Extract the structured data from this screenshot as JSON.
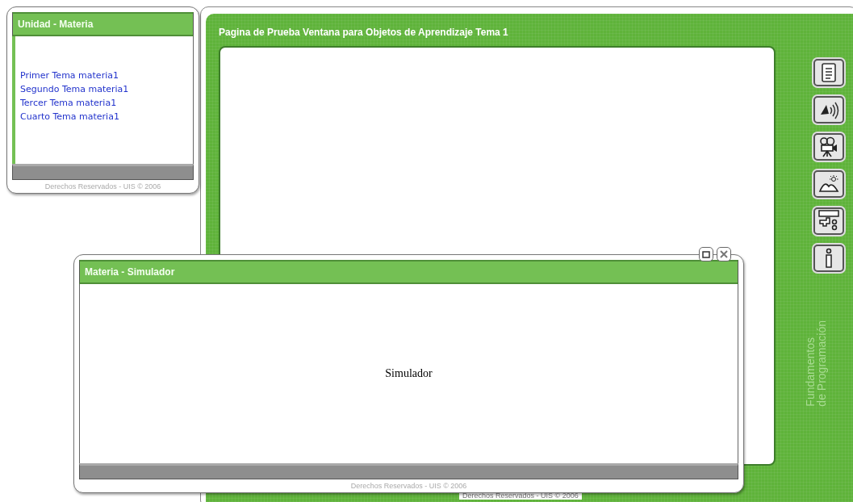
{
  "unit_window": {
    "title": "Unidad - Materia",
    "links": [
      "Primer Tema materia1",
      "Segundo Tema materia1",
      "Tercer Tema materia1",
      "Cuarto Tema materia1"
    ],
    "footer": "Derechos Reservados - UIS © 2006"
  },
  "main_window": {
    "title": "Pagina de Prueba Ventana para Objetos de Aprendizaje Tema 1",
    "tools": [
      {
        "kind": "document"
      },
      {
        "kind": "audio"
      },
      {
        "kind": "video"
      },
      {
        "kind": "image"
      },
      {
        "kind": "simulator"
      },
      {
        "kind": "info"
      }
    ],
    "logo_lines": [
      "Fundamentos",
      "de Programación"
    ],
    "footer": "Derechos Reservados - UIS © 2006"
  },
  "simulator_window": {
    "title": "Materia - Simulador",
    "content": "Simulador",
    "footer": "Derechos Reservados - UIS © 2006"
  }
}
